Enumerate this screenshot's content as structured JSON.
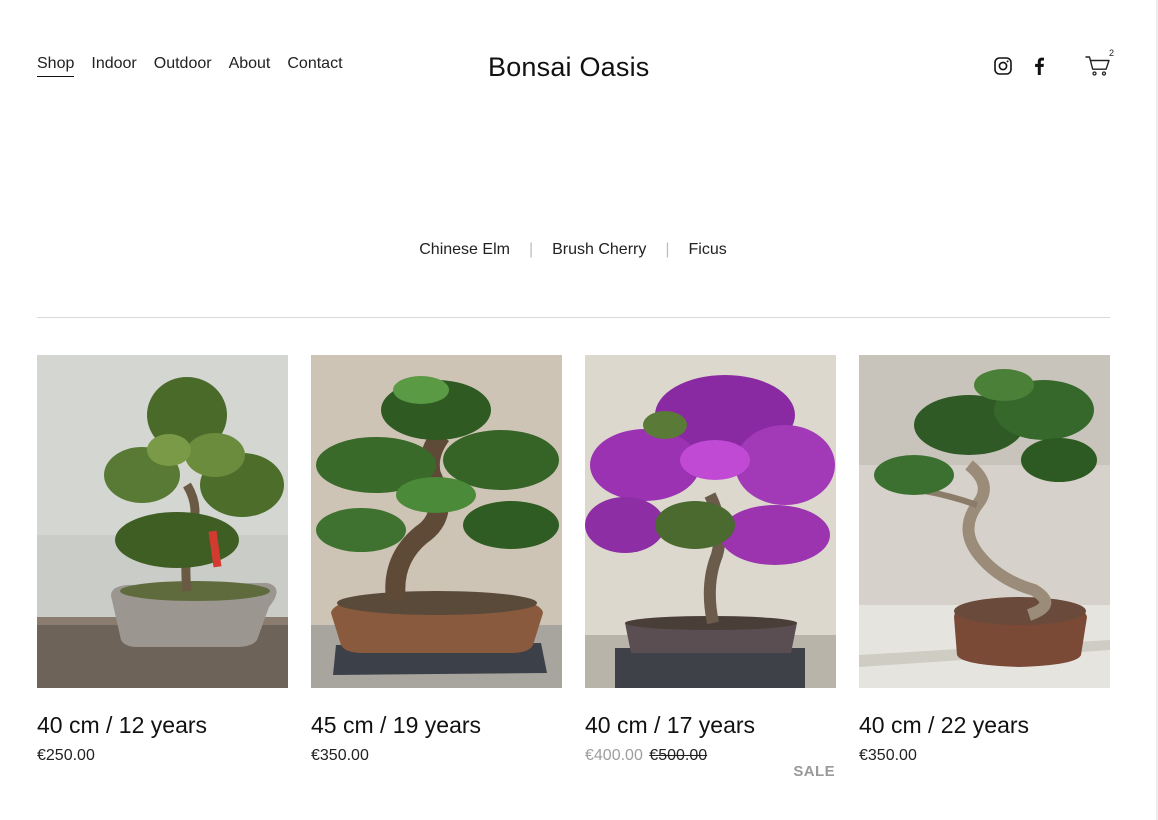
{
  "header": {
    "nav": [
      {
        "label": "Shop",
        "active": true
      },
      {
        "label": "Indoor"
      },
      {
        "label": "Outdoor"
      },
      {
        "label": "About"
      },
      {
        "label": "Contact"
      }
    ],
    "brand": "Bonsai Oasis",
    "icons": [
      "instagram-icon",
      "facebook-icon",
      "cart-icon"
    ],
    "cart_count": "2"
  },
  "filters": [
    "Chinese Elm",
    "Brush Cherry",
    "Ficus"
  ],
  "products": [
    {
      "title": "40 cm / 12 years",
      "price": "€250.00",
      "image": "juniper-bonsai-on-wood"
    },
    {
      "title": "45 cm / 19 years",
      "price": "€350.00",
      "image": "pine-bonsai-brown-pot"
    },
    {
      "title": "40 cm / 17 years",
      "sale_price": "€400.00",
      "original_price": "€500.00",
      "badge": "SALE",
      "image": "bougainvillea-bonsai-purple"
    },
    {
      "title": "40 cm / 22 years",
      "price": "€350.00",
      "image": "juniper-deadwood-bonsai"
    }
  ],
  "colors": {
    "text": "#111111",
    "muted": "#9e9e9e",
    "rule": "#d9d9d9",
    "bg": "#ffffff"
  }
}
